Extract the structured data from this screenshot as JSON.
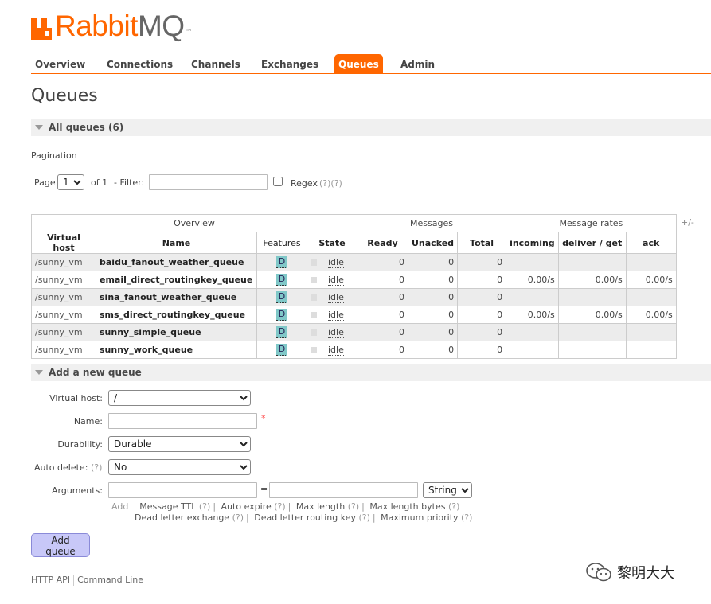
{
  "logo": {
    "brand": "Rabbit",
    "suffix": "MQ",
    "tm": "™"
  },
  "nav": {
    "tabs": [
      {
        "label": "Overview"
      },
      {
        "label": "Connections"
      },
      {
        "label": "Channels"
      },
      {
        "label": "Exchanges"
      },
      {
        "label": "Queues",
        "active": true
      },
      {
        "label": "Admin"
      }
    ]
  },
  "page": {
    "title": "Queues"
  },
  "all_queues": {
    "heading": "All queues (6)"
  },
  "pagination": {
    "label": "Pagination",
    "page_label": "Page",
    "page_value": "1",
    "of_label": "of 1",
    "filter_label": "- Filter:",
    "filter_value": "",
    "regex_label": "Regex",
    "regex_help": "(?)(?)",
    "regex_checked": false
  },
  "table": {
    "groups": {
      "overview": "Overview",
      "messages": "Messages",
      "rates": "Message rates"
    },
    "columns": {
      "vhost": "Virtual host",
      "name": "Name",
      "features": "Features",
      "state": "State",
      "ready": "Ready",
      "unacked": "Unacked",
      "total": "Total",
      "incoming": "incoming",
      "deliver": "deliver / get",
      "ack": "ack"
    },
    "plus_minus": "+/-",
    "rows": [
      {
        "vhost": "/sunny_vm",
        "name": "baidu_fanout_weather_queue",
        "feature": "D",
        "state": "idle",
        "ready": "0",
        "unacked": "0",
        "total": "0",
        "incoming": "",
        "deliver": "",
        "ack": ""
      },
      {
        "vhost": "/sunny_vm",
        "name": "email_direct_routingkey_queue",
        "feature": "D",
        "state": "idle",
        "ready": "0",
        "unacked": "0",
        "total": "0",
        "incoming": "0.00/s",
        "deliver": "0.00/s",
        "ack": "0.00/s"
      },
      {
        "vhost": "/sunny_vm",
        "name": "sina_fanout_weather_queue",
        "feature": "D",
        "state": "idle",
        "ready": "0",
        "unacked": "0",
        "total": "0",
        "incoming": "",
        "deliver": "",
        "ack": ""
      },
      {
        "vhost": "/sunny_vm",
        "name": "sms_direct_routingkey_queue",
        "feature": "D",
        "state": "idle",
        "ready": "0",
        "unacked": "0",
        "total": "0",
        "incoming": "0.00/s",
        "deliver": "0.00/s",
        "ack": "0.00/s"
      },
      {
        "vhost": "/sunny_vm",
        "name": "sunny_simple_queue",
        "feature": "D",
        "state": "idle",
        "ready": "0",
        "unacked": "0",
        "total": "0",
        "incoming": "",
        "deliver": "",
        "ack": ""
      },
      {
        "vhost": "/sunny_vm",
        "name": "sunny_work_queue",
        "feature": "D",
        "state": "idle",
        "ready": "0",
        "unacked": "0",
        "total": "0",
        "incoming": "",
        "deliver": "",
        "ack": ""
      }
    ]
  },
  "add_queue": {
    "heading": "Add a new queue",
    "vhost_label": "Virtual host:",
    "vhost_value": "/",
    "name_label": "Name:",
    "name_value": "",
    "required_mark": "*",
    "durability_label": "Durability:",
    "durability_value": "Durable",
    "auto_delete_label": "Auto delete:",
    "auto_delete_help": "(?)",
    "auto_delete_value": "No",
    "arguments_label": "Arguments:",
    "equals": "=",
    "arg_type_value": "String",
    "add_label": "Add",
    "help": "(?)",
    "arg_links_1": [
      "Message TTL",
      "Auto expire",
      "Max length",
      "Max length bytes"
    ],
    "arg_links_2": [
      "Dead letter exchange",
      "Dead letter routing key",
      "Maximum priority"
    ],
    "submit_label": "Add queue"
  },
  "footer": {
    "http_api": "HTTP API",
    "command_line": "Command Line"
  },
  "watermark": {
    "text": "黎明大大"
  },
  "colors": {
    "accent": "#ff6600",
    "feature_badge": "#80c8c8",
    "button": "#c8c8f8"
  }
}
